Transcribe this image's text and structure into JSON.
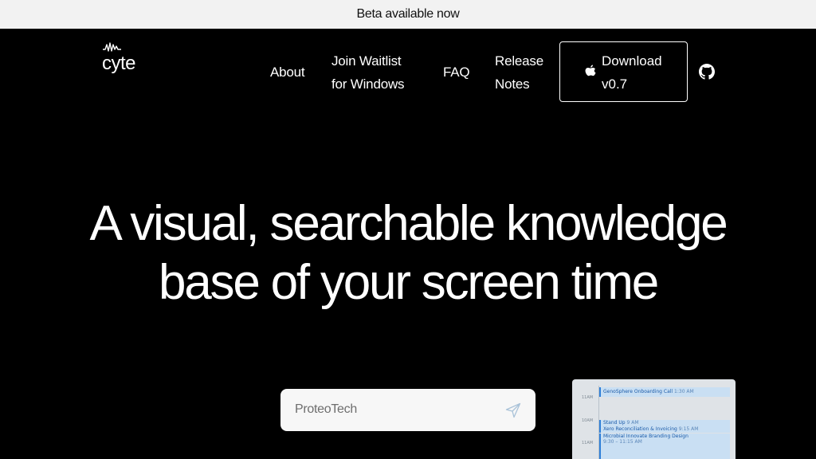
{
  "banner": {
    "text": "Beta available now"
  },
  "logo": {
    "text": "cyte"
  },
  "nav": {
    "about": "About",
    "waitlist": "Join Waitlist for Windows",
    "faq": "FAQ",
    "release_notes": "Release Notes",
    "download": "Download v0.7"
  },
  "hero": {
    "line1": "A visual, searchable knowledge",
    "line2": "base of your screen time"
  },
  "search": {
    "value": "ProteoTech"
  },
  "calendar": {
    "times": [
      "11AM",
      "10AM",
      "11AM"
    ],
    "events": [
      {
        "title": "GenoSphere Onboarding Call",
        "time": "1:30 AM"
      },
      {
        "title": "Stand Up",
        "time": "9 AM"
      },
      {
        "title": "Xero Reconciliation & Invoicing",
        "time": "9:15 AM"
      },
      {
        "title": "Microbial Innovate Branding Design",
        "time": ""
      },
      {
        "title": "9:30 – 11:15 AM",
        "time": ""
      }
    ]
  },
  "colors": {
    "background": "#000000",
    "banner": "#f2f2f2",
    "accent": "#2f7fd8"
  }
}
